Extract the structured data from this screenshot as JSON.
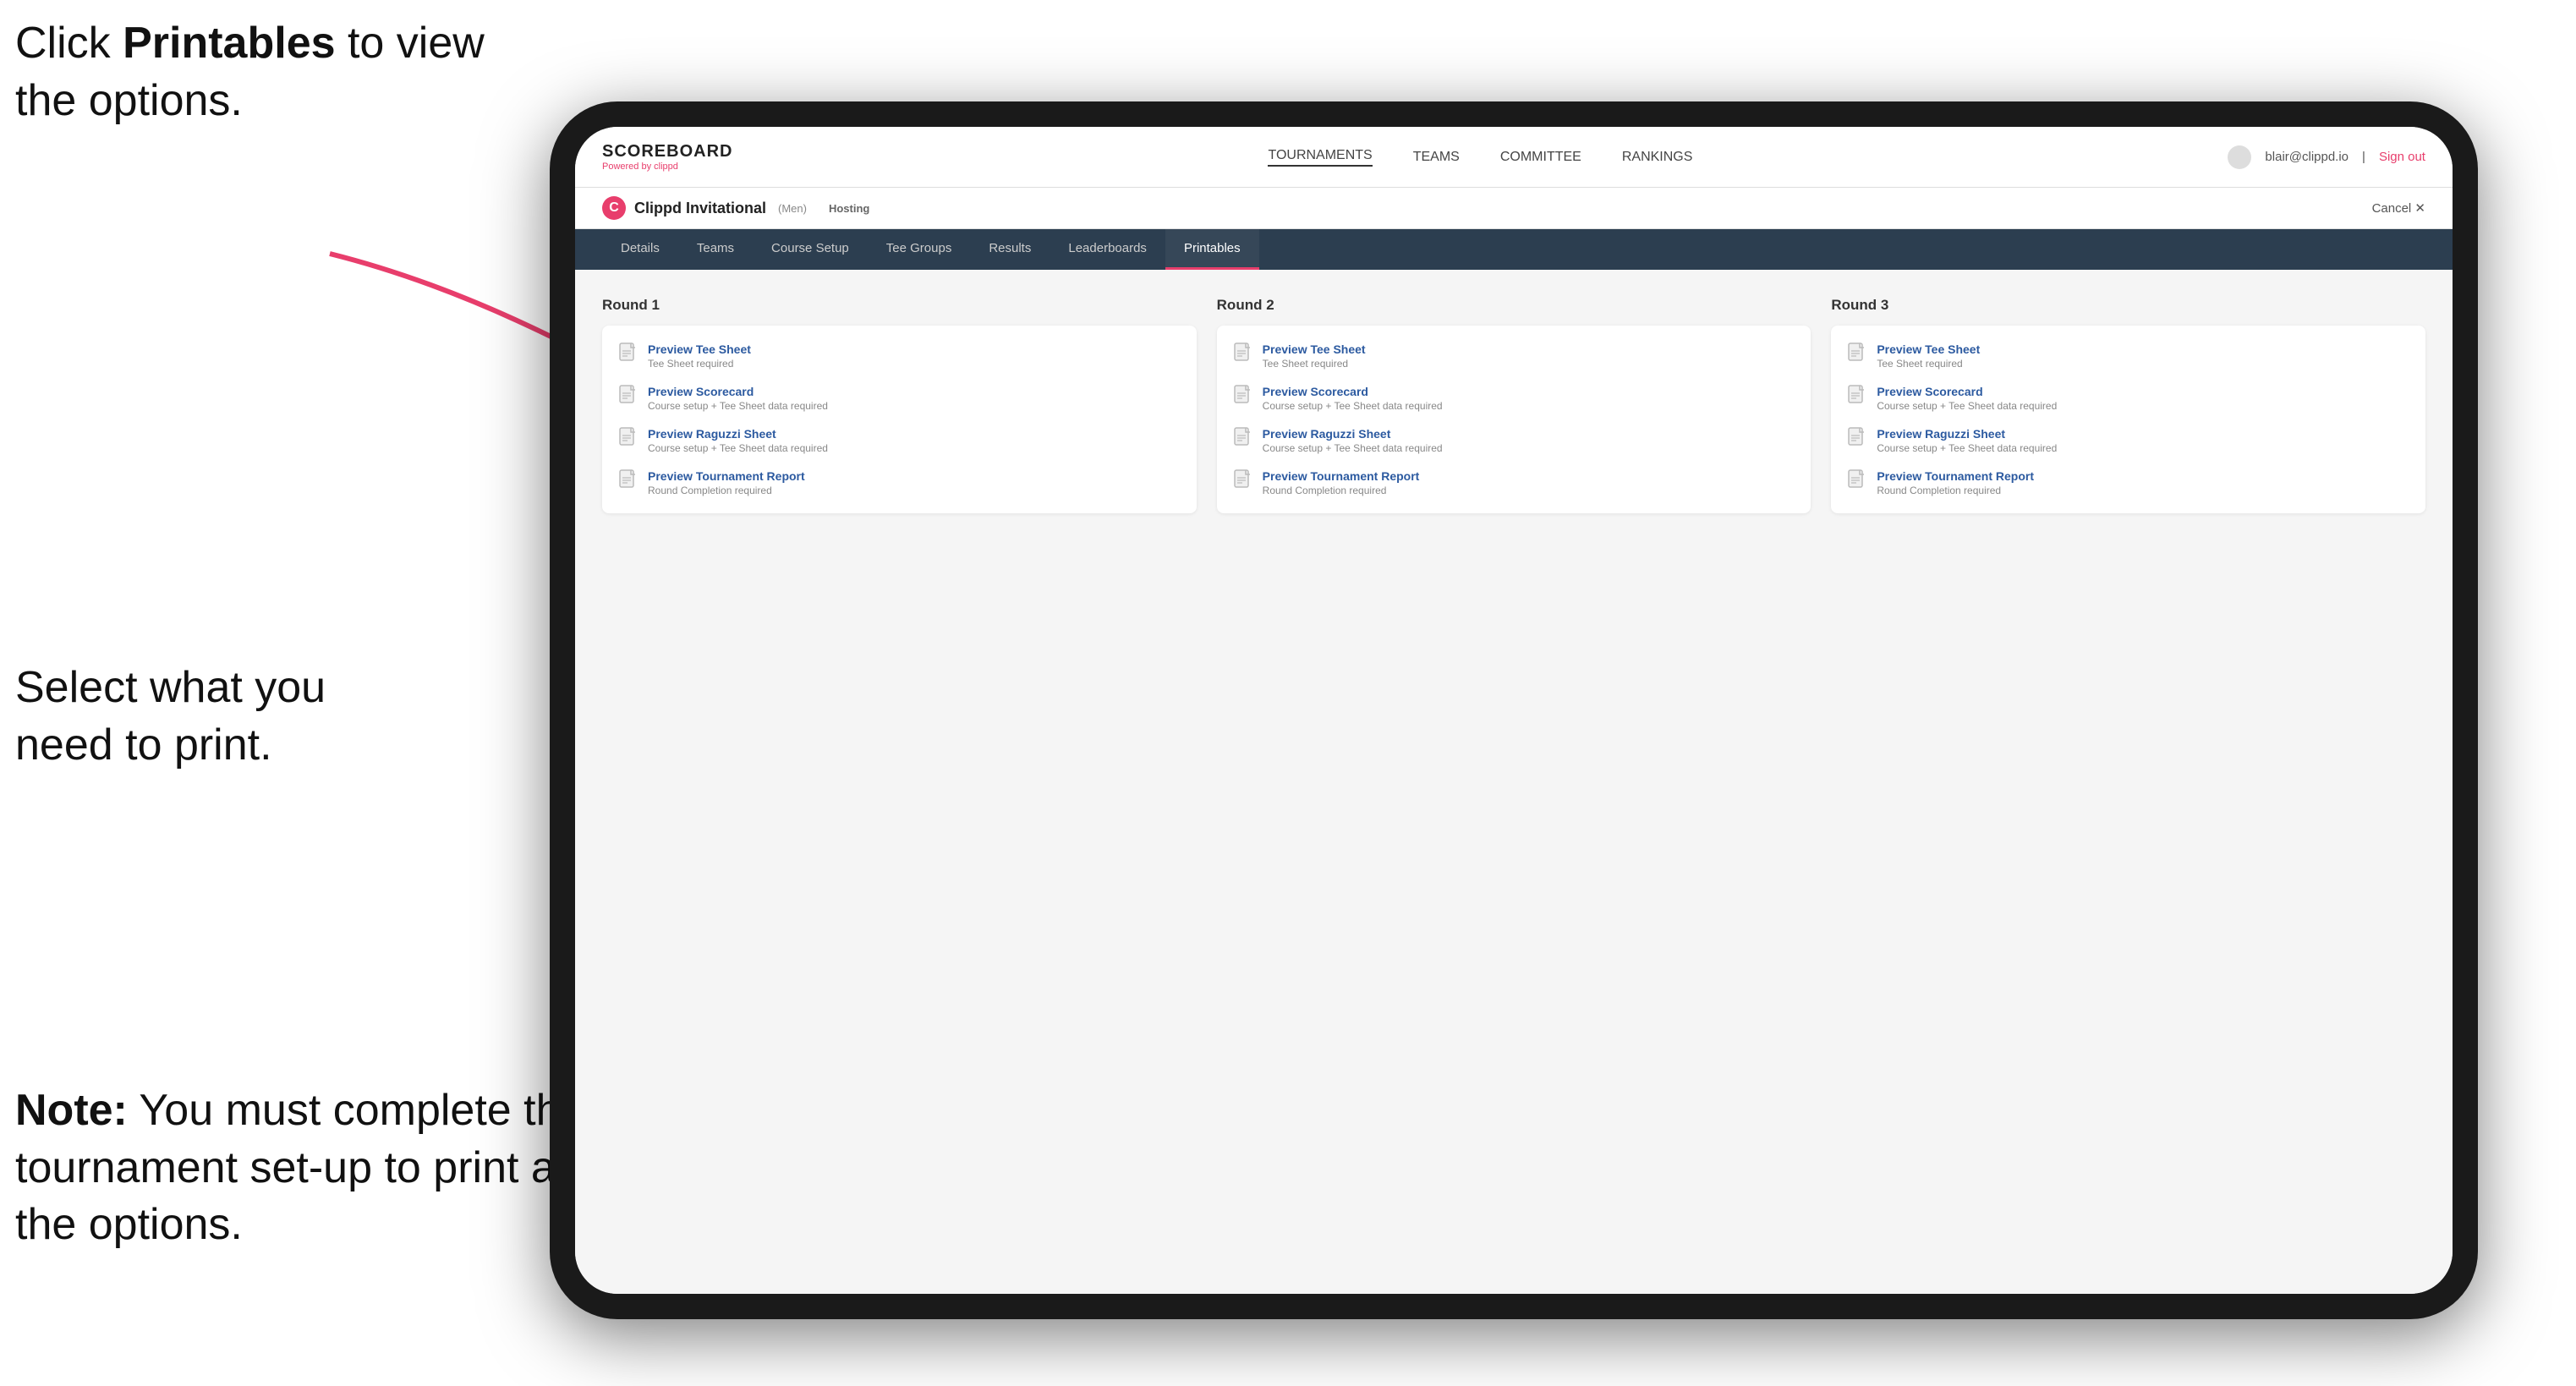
{
  "annotations": {
    "top": {
      "line1": "Click ",
      "bold": "Printables",
      "line2": " to",
      "line3": "view the options."
    },
    "middle": {
      "text": "Select what you\nneed to print."
    },
    "bottom": {
      "bold": "Note:",
      "text": " You must\ncomplete the\ntournament set-up\nto print all the options."
    }
  },
  "nav": {
    "logo_title": "SCOREBOARD",
    "logo_subtitle": "Powered by clippd",
    "links": [
      "TOURNAMENTS",
      "TEAMS",
      "COMMITTEE",
      "RANKINGS"
    ],
    "active_link": "TOURNAMENTS",
    "user": "blair@clippd.io",
    "sign_out": "Sign out"
  },
  "tournament": {
    "logo": "C",
    "name": "Clippd Invitational",
    "badge": "(Men)",
    "hosting": "Hosting",
    "cancel": "Cancel ✕"
  },
  "sub_tabs": [
    "Details",
    "Teams",
    "Course Setup",
    "Tee Groups",
    "Results",
    "Leaderboards",
    "Printables"
  ],
  "active_tab": "Printables",
  "rounds": [
    {
      "label": "Round 1",
      "items": [
        {
          "title": "Preview Tee Sheet",
          "subtitle": "Tee Sheet required"
        },
        {
          "title": "Preview Scorecard",
          "subtitle": "Course setup + Tee Sheet data required"
        },
        {
          "title": "Preview Raguzzi Sheet",
          "subtitle": "Course setup + Tee Sheet data required"
        },
        {
          "title": "Preview Tournament Report",
          "subtitle": "Round Completion required"
        }
      ]
    },
    {
      "label": "Round 2",
      "items": [
        {
          "title": "Preview Tee Sheet",
          "subtitle": "Tee Sheet required"
        },
        {
          "title": "Preview Scorecard",
          "subtitle": "Course setup + Tee Sheet data required"
        },
        {
          "title": "Preview Raguzzi Sheet",
          "subtitle": "Course setup + Tee Sheet data required"
        },
        {
          "title": "Preview Tournament Report",
          "subtitle": "Round Completion required"
        }
      ]
    },
    {
      "label": "Round 3",
      "items": [
        {
          "title": "Preview Tee Sheet",
          "subtitle": "Tee Sheet required"
        },
        {
          "title": "Preview Scorecard",
          "subtitle": "Course setup + Tee Sheet data required"
        },
        {
          "title": "Preview Raguzzi Sheet",
          "subtitle": "Course setup + Tee Sheet data required"
        },
        {
          "title": "Preview Tournament Report",
          "subtitle": "Round Completion required"
        }
      ]
    }
  ]
}
